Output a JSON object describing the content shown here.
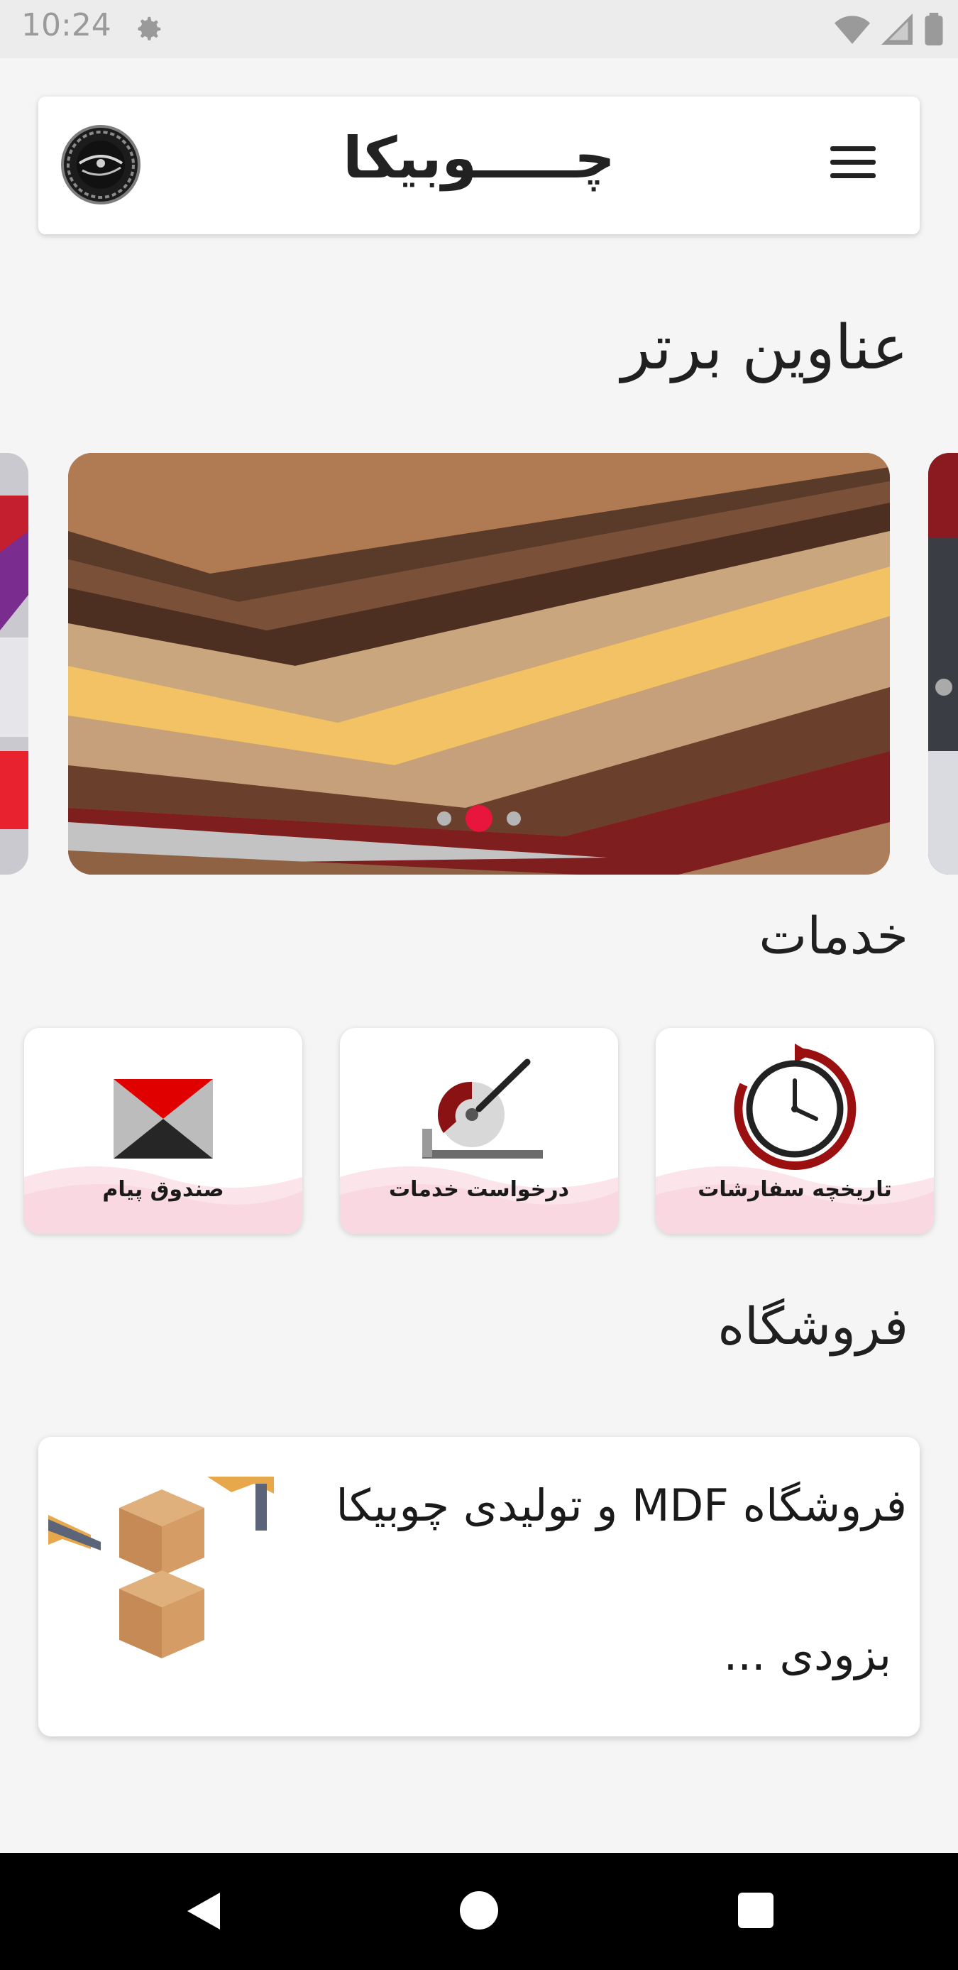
{
  "status_bar": {
    "time": "10:24",
    "icons": [
      "gear-icon",
      "wifi-icon",
      "signal-icon",
      "battery-icon"
    ]
  },
  "header": {
    "app_title": "چـــــوبیکا",
    "menu_icon": "hamburger-menu-icon",
    "logo_icon": "choobika-logo"
  },
  "sections": {
    "top_titles": "عناوین برتر",
    "services": "خدمات",
    "store": "فروشگاه"
  },
  "carousel": {
    "slides": [
      "mdf-sheets-image",
      "wood-panels-image",
      "machine-image"
    ],
    "active_index": 1,
    "dot_count": 3
  },
  "services": [
    {
      "label": "تاریخچه سفارشات",
      "icon": "order-history-clock-icon"
    },
    {
      "label": "درخواست خدمات",
      "icon": "saw-cutter-icon"
    },
    {
      "label": "صندوق پیام",
      "icon": "mail-envelope-icon"
    }
  ],
  "store": {
    "title": "فروشگاه MDF و تولیدی چوبیکا",
    "subtitle": "بزودی ...",
    "image_icon": "cardboard-boxes-image"
  },
  "nav": {
    "back_icon": "back-triangle-icon",
    "home_icon": "home-circle-icon",
    "recent_icon": "recent-apps-square-icon"
  },
  "colors": {
    "accent": "#e8153c",
    "background": "#f5f5f5",
    "card": "#ffffff"
  }
}
